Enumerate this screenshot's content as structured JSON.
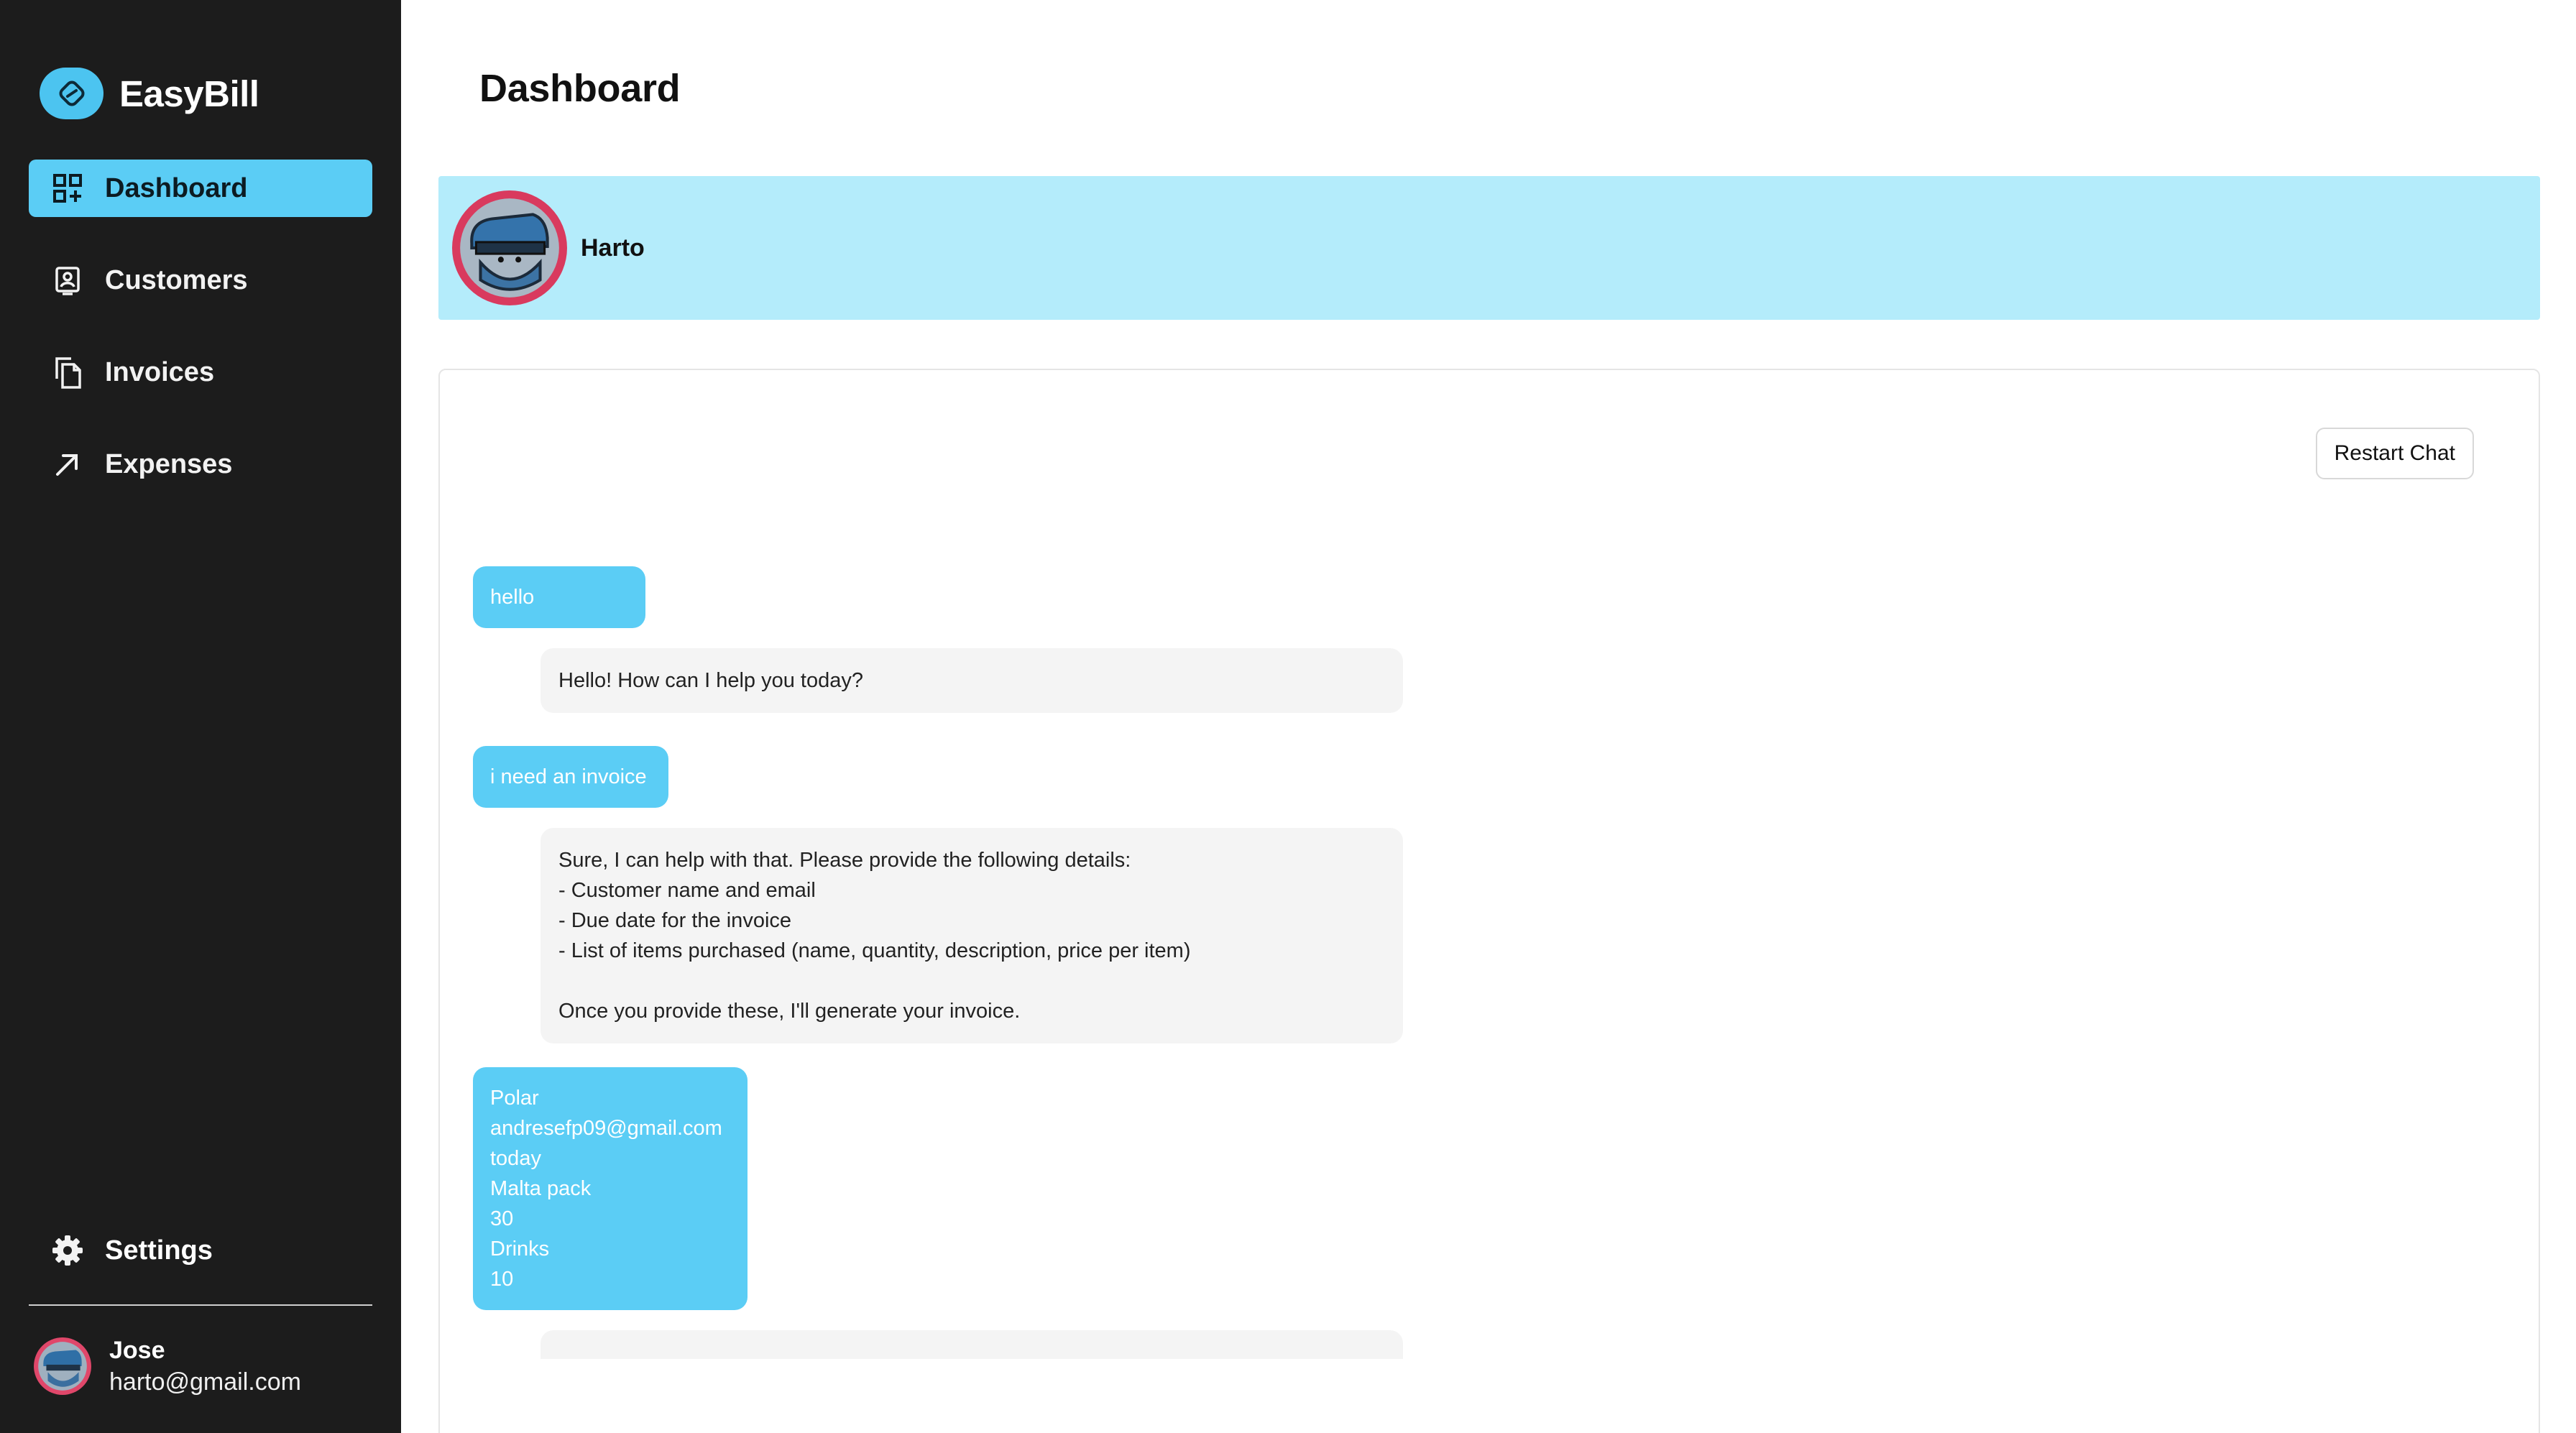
{
  "app": {
    "name": "EasyBill"
  },
  "sidebar": {
    "items": [
      {
        "label": "Dashboard",
        "icon": "dashboard-grid-icon",
        "active": true
      },
      {
        "label": "Customers",
        "icon": "customer-badge-icon",
        "active": false
      },
      {
        "label": "Invoices",
        "icon": "documents-icon",
        "active": false
      },
      {
        "label": "Expenses",
        "icon": "arrow-up-right-icon",
        "active": false
      }
    ],
    "settings_label": "Settings",
    "user": {
      "name": "Jose",
      "email": "harto@gmail.com"
    }
  },
  "page": {
    "title": "Dashboard"
  },
  "agent": {
    "name": "Harto"
  },
  "chat": {
    "restart_label": "Restart Chat",
    "messages": [
      {
        "role": "user",
        "text": "hello"
      },
      {
        "role": "bot",
        "text": "Hello! How can I help you today?"
      },
      {
        "role": "user",
        "text": "i need an invoice"
      },
      {
        "role": "bot",
        "text": "Sure, I can help with that. Please provide the following details:\n- Customer name and email\n- Due date for the invoice\n- List of items purchased (name, quantity, description, price per item)\n\nOnce you provide these, I'll generate your invoice."
      },
      {
        "role": "user",
        "text": "Polar\nandresefp09@gmail.com\ntoday\nMalta pack\n30\nDrinks\n10"
      }
    ]
  },
  "colors": {
    "sidebar_bg": "#1c1c1c",
    "accent": "#5bcdf5",
    "agent_bar": "#b4ecfb",
    "bot_bubble": "#f4f4f4"
  }
}
